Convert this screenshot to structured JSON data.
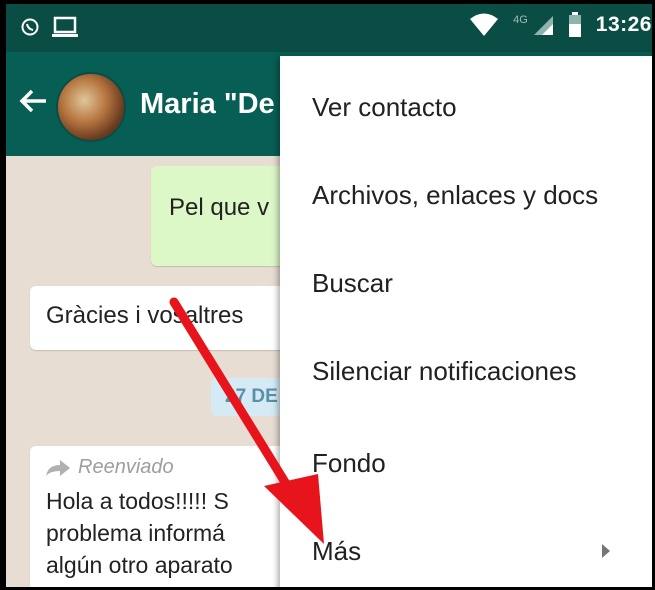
{
  "status": {
    "time": "13:26",
    "network": "4G",
    "icons": [
      "whatsapp-icon",
      "laptop-icon",
      "wifi-icon",
      "signal-icon",
      "battery-icon"
    ]
  },
  "appbar": {
    "contact_name": "Maria \"De"
  },
  "chat": {
    "outgoing_text": "Pel que v",
    "incoming_text": "Gràcies i vosaltres",
    "date_chip": "27 DE",
    "forwarded_label": "Reenviado",
    "forwarded_lines": [
      "Hola a todos!!!!! S",
      "problema informá",
      "algún otro aparato"
    ]
  },
  "menu": {
    "items": [
      {
        "label": "Ver contacto"
      },
      {
        "label": "Archivos, enlaces y docs"
      },
      {
        "label": "Buscar"
      },
      {
        "label": "Silenciar notificaciones"
      },
      {
        "label": "Fondo"
      },
      {
        "label": "Más"
      }
    ]
  },
  "colors": {
    "statusbar": "#0a4d44",
    "appbar": "#075e54",
    "outgoing": "#dcf8c6",
    "annotation": "#e8141b"
  }
}
